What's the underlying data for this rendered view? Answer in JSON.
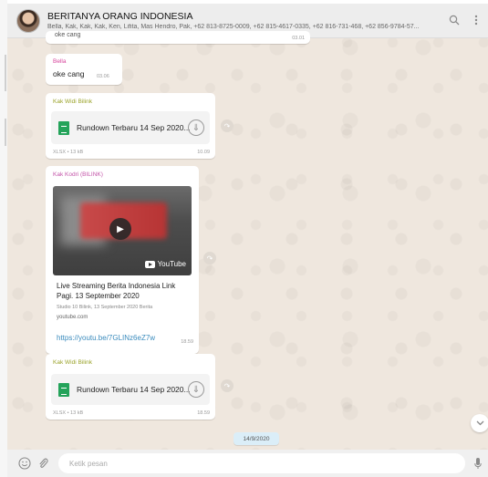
{
  "header": {
    "title": "BERITANYA ORANG INDONESIA",
    "members": "Bella, Kak, Kak, Kak, Ken, Lifita, Mas Hendro, Pak, +62 813-8725-0009, +62 815-4617-0335, +62 816-731-468, +62 856-9784-57...",
    "search_icon": "search-icon",
    "menu_icon": "menu-icon"
  },
  "messages": {
    "partial": {
      "text": "oke cang",
      "time": "03.01"
    },
    "bella": {
      "sender": "Bella",
      "text": "oke cang",
      "time": "03.06"
    },
    "doc1": {
      "sender": "Kak Widi Bilink",
      "filename": "Rundown Terbaru 14 Sep 2020...",
      "meta": "XLSX • 13 kB",
      "time": "10.09"
    },
    "video": {
      "sender": "Kak Kodri (BILINK)",
      "youtube_label": "YouTube",
      "title_line1": "Live Streaming Berita Indonesia Link",
      "title_line2": "Pagi. 13 September 2020",
      "description": "Studio 10 Bilink, 13 September 2020 Berita",
      "domain": "youtube.com",
      "url": "https://youtu.be/7GLINz6eZ7w",
      "time": "18.59"
    },
    "doc2": {
      "sender": "Kak Widi Bilink",
      "filename": "Rundown Terbaru 14 Sep 2020...",
      "meta": "XLSX • 13 kB",
      "time": "18.59"
    }
  },
  "date_divider": "14/9/2020",
  "footer": {
    "placeholder": "Ketik pesan",
    "emoji_icon": "emoji-icon",
    "attach_icon": "paperclip-icon",
    "mic_icon": "microphone-icon"
  },
  "colors": {
    "sender_bella": "#d6439b",
    "sender_widi": "#9aa32a",
    "sender_kodri": "#c353a8",
    "link": "#3a8bbd",
    "chat_bg": "#efe7de"
  }
}
